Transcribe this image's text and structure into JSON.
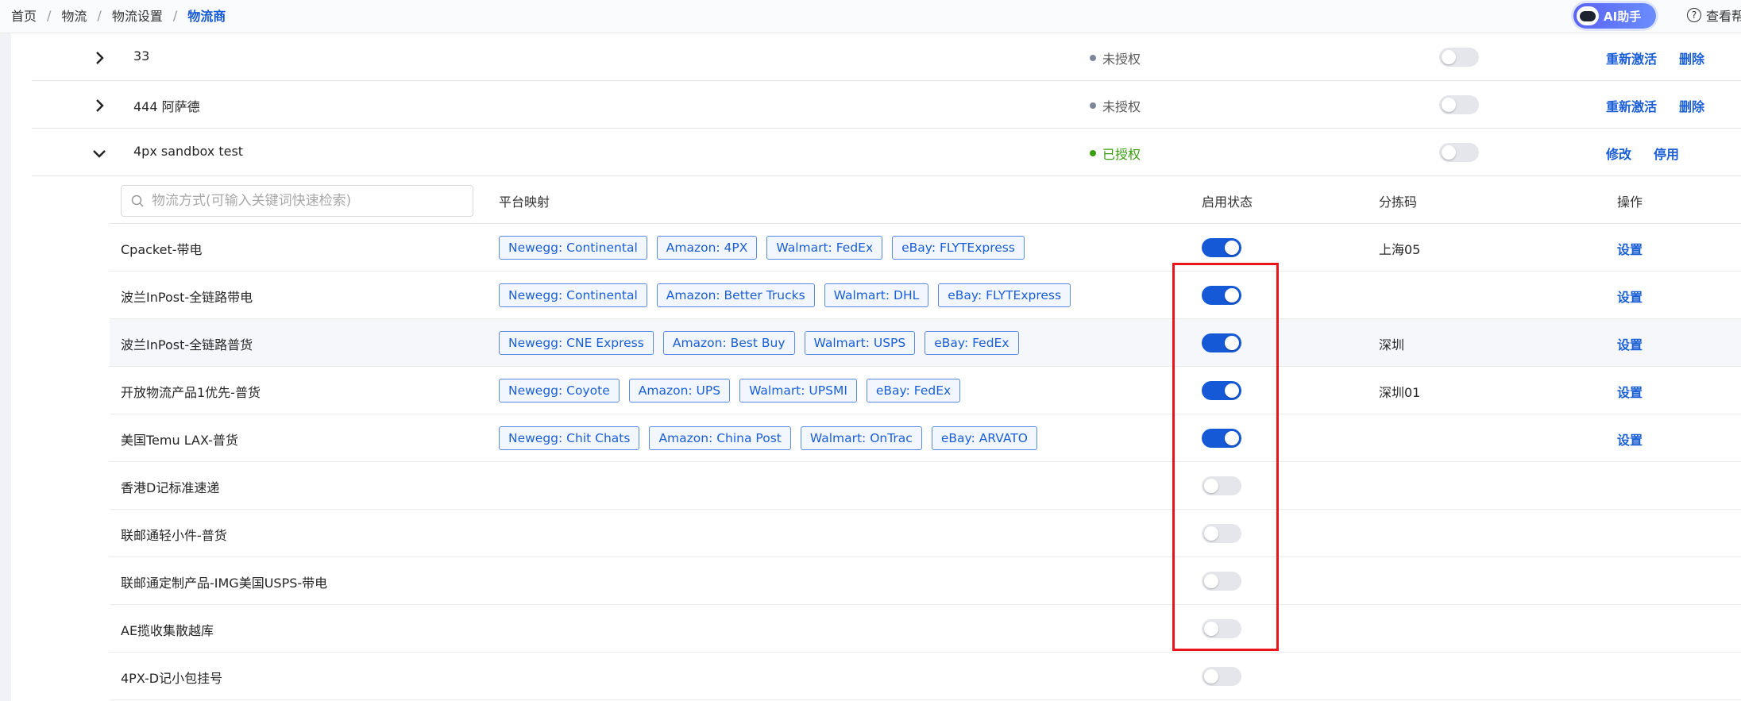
{
  "breadcrumb": [
    "首页",
    "物流",
    "物流设置",
    "物流商"
  ],
  "header": {
    "ai_label": "AI助手",
    "help_label": "查看帮"
  },
  "providers": [
    {
      "name": "33",
      "status": "未授权",
      "authorized": false,
      "enabled": false,
      "actions": [
        "重新激活",
        "删除"
      ],
      "expanded": false
    },
    {
      "name": "444 阿萨德",
      "status": "未授权",
      "authorized": false,
      "enabled": false,
      "actions": [
        "重新激活",
        "删除"
      ],
      "expanded": false
    },
    {
      "name": "4px sandbox test",
      "status": "已授权",
      "authorized": true,
      "enabled": false,
      "actions": [
        "修改",
        "停用"
      ],
      "expanded": true
    }
  ],
  "sub": {
    "search_placeholder": "物流方式(可输入关键词快速检索)",
    "columns": {
      "mapping": "平台映射",
      "status": "启用状态",
      "sort_code": "分拣码",
      "op": "操作"
    },
    "rows": [
      {
        "name": "Cpacket-带电",
        "tags": [
          "Newegg: Continental",
          "Amazon: 4PX",
          "Walmart: FedEx",
          "eBay: FLYTExpress"
        ],
        "enabled": true,
        "sort_code": "上海05",
        "action": "设置"
      },
      {
        "name": "波兰InPost-全链路带电",
        "tags": [
          "Newegg: Continental",
          "Amazon: Better Trucks",
          "Walmart: DHL",
          "eBay: FLYTExpress"
        ],
        "enabled": true,
        "sort_code": "",
        "action": "设置"
      },
      {
        "name": "波兰InPost-全链路普货",
        "tags": [
          "Newegg: CNE Express",
          "Amazon: Best Buy",
          "Walmart: USPS",
          "eBay: FedEx"
        ],
        "enabled": true,
        "sort_code": "深圳",
        "action": "设置"
      },
      {
        "name": "开放物流产品1优先-普货",
        "tags": [
          "Newegg: Coyote",
          "Amazon: UPS",
          "Walmart: UPSMI",
          "eBay: FedEx"
        ],
        "enabled": true,
        "sort_code": "深圳01",
        "action": "设置"
      },
      {
        "name": "美国Temu LAX-普货",
        "tags": [
          "Newegg: Chit Chats",
          "Amazon: China Post",
          "Walmart: OnTrac",
          "eBay: ARVATO"
        ],
        "enabled": true,
        "sort_code": "",
        "action": "设置"
      },
      {
        "name": "香港D记标准速递",
        "tags": [],
        "enabled": false,
        "sort_code": "",
        "action": ""
      },
      {
        "name": "联邮通轻小件-普货",
        "tags": [],
        "enabled": false,
        "sort_code": "",
        "action": ""
      },
      {
        "name": "联邮通定制产品-IMG美国USPS-带电",
        "tags": [],
        "enabled": false,
        "sort_code": "",
        "action": ""
      },
      {
        "name": "AE揽收集散越库",
        "tags": [],
        "enabled": false,
        "sort_code": "",
        "action": ""
      },
      {
        "name": "4PX-D记小包挂号",
        "tags": [],
        "enabled": false,
        "sort_code": "",
        "action": ""
      }
    ]
  },
  "colors": {
    "accent": "#1559d6",
    "highlight_box": "#e8141a",
    "authorized": "#389e0d",
    "unauthorized": "#7b8799"
  }
}
